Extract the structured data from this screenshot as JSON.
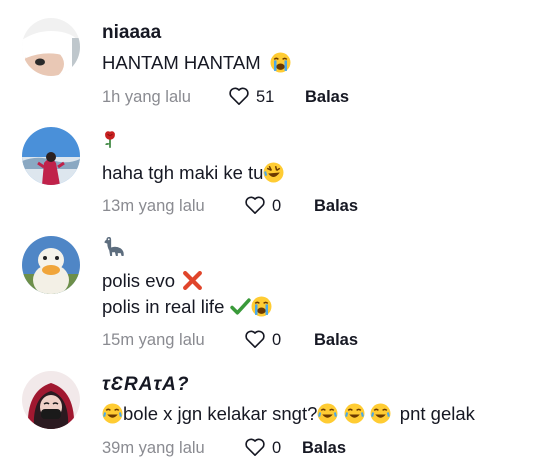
{
  "comments": [
    {
      "username": "niaaaa",
      "lines": [
        "HANTAM HANTAM"
      ],
      "time": "1h yang lalu",
      "likes": "51",
      "reply_label": "Balas"
    },
    {
      "username": "",
      "lines": [
        "haha tgh maki ke tu"
      ],
      "time": "13m yang lalu",
      "likes": "0",
      "reply_label": "Balas"
    },
    {
      "username": "",
      "lines": [
        "polis evo",
        "polis in real life"
      ],
      "time": "15m yang lalu",
      "likes": "0",
      "reply_label": "Balas"
    },
    {
      "username": "τƐRAτA?",
      "lines": [
        "bole x jgn kelakar sngt?",
        "pnt gelak"
      ],
      "time": "39m yang lalu",
      "likes": "0",
      "reply_label": "Balas"
    }
  ],
  "colors": {
    "text": "#161823",
    "meta": "#8a8b91",
    "emoji_yellow": "#ffcc33",
    "cross_red": "#e0452b",
    "check_green": "#3a9a3a",
    "rose_red": "#c82020"
  }
}
